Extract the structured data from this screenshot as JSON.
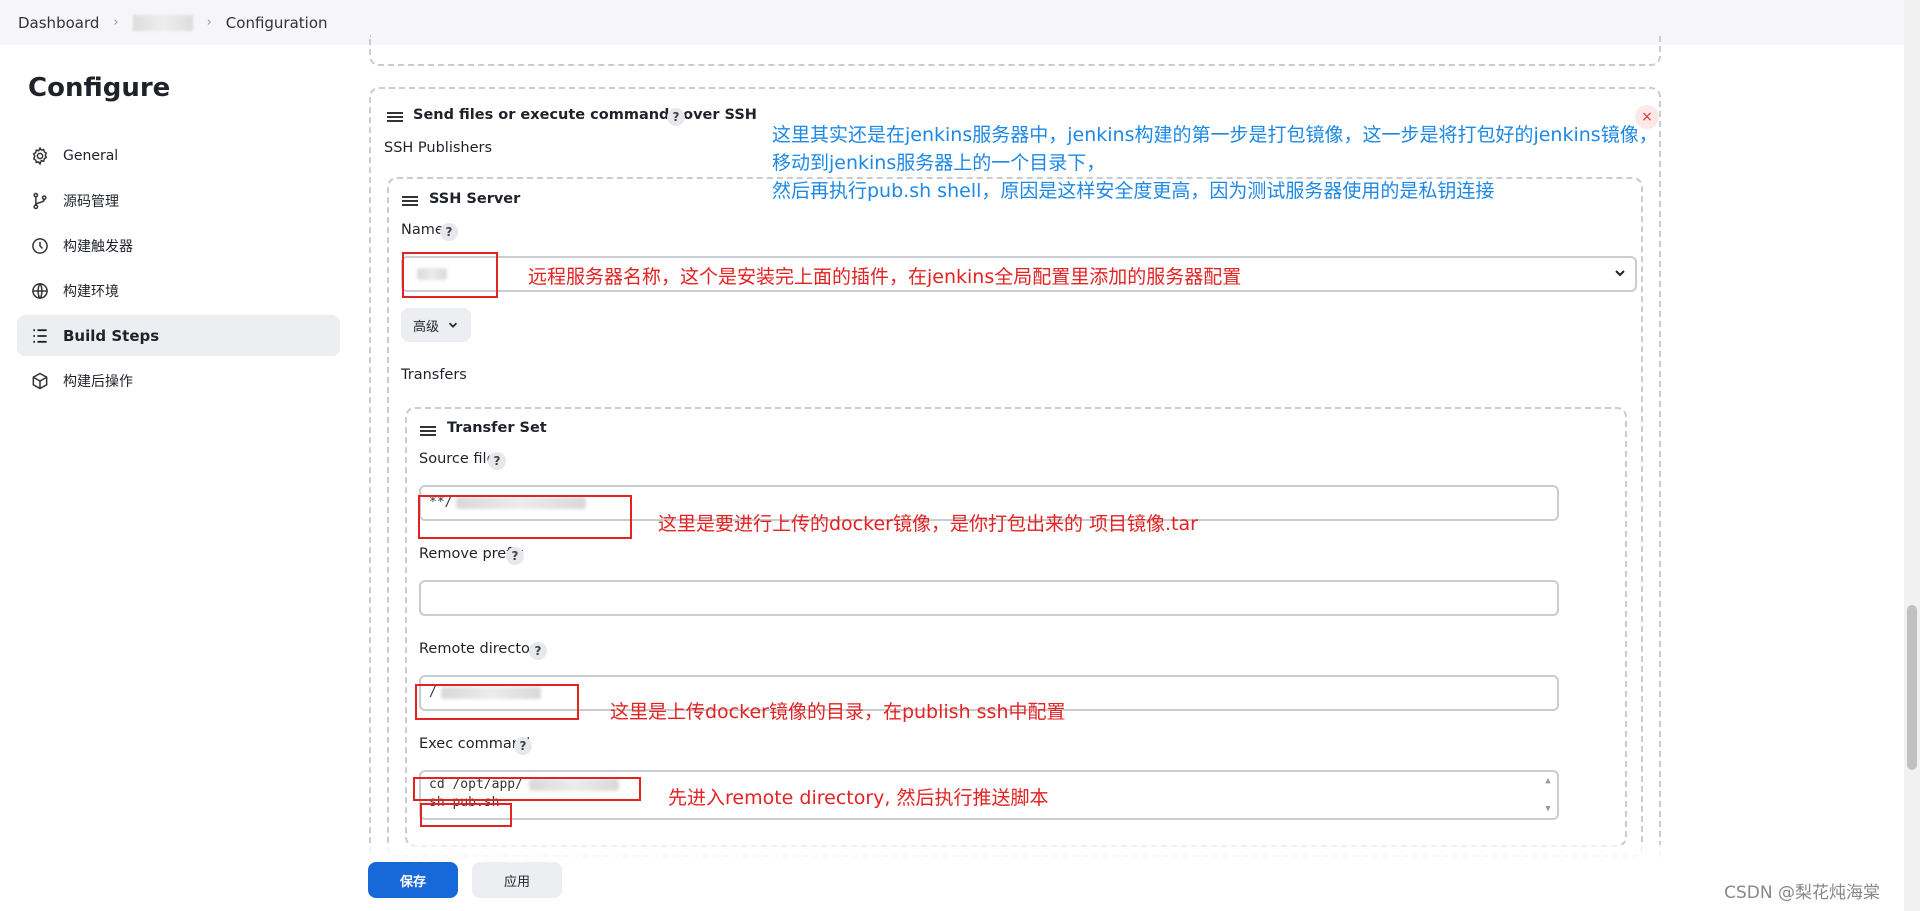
{
  "breadcrumb": {
    "home": "Dashboard",
    "current": "Configuration"
  },
  "sidebar": {
    "title": "Configure",
    "items": [
      {
        "label": "General",
        "icon": "gear-icon"
      },
      {
        "label": "源码管理",
        "icon": "branch-icon"
      },
      {
        "label": "构建触发器",
        "icon": "clock-icon"
      },
      {
        "label": "构建环境",
        "icon": "globe-icon"
      },
      {
        "label": "Build Steps",
        "icon": "list-icon",
        "active": true
      },
      {
        "label": "构建后操作",
        "icon": "cube-icon"
      }
    ]
  },
  "ssh_step": {
    "title": "Send files or execute commands over SSH",
    "publishers_label": "SSH Publishers",
    "close_symbol": "×",
    "server": {
      "title": "SSH Server",
      "name_label": "Name",
      "advanced_label": "高级",
      "transfers_label": "Transfers",
      "transfer_set": {
        "title": "Transfer Set",
        "source_files_label": "Source files",
        "source_files_value": "**/",
        "remove_prefix_label": "Remove prefix",
        "remove_prefix_value": "",
        "remote_dir_label": "Remote directory",
        "remote_dir_value": "/",
        "exec_label": "Exec command",
        "exec_line1": "cd /opt/app/",
        "exec_line2": "sh pub.sh"
      }
    }
  },
  "help_symbol": "?",
  "annotations": {
    "blue_line1": "这里其实还是在jenkins服务器中，jenkins构建的第一步是打包镜像，这一步是将打包好的jenkins镜像，",
    "blue_line2": "移动到jenkins服务器上的一个目录下，",
    "blue_line3": "然后再执行pub.sh shell，原因是这样安全度更高，因为测试服务器使用的是私钥连接",
    "name_note": "远程服务器名称，这个是安装完上面的插件，在jenkins全局配置里添加的服务器配置",
    "source_note": "这里是要进行上传的docker镜像，是你打包出来的 项目镜像.tar",
    "remote_note": "这里是上传docker镜像的目录，在publish ssh中配置",
    "exec_note": "先进入remote directory, 然后执行推送脚本"
  },
  "footer": {
    "save_label": "保存",
    "apply_label": "应用"
  },
  "watermark": "CSDN @梨花炖海棠",
  "colors": {
    "primary": "#1768d8",
    "annotation_red": "#e32222",
    "annotation_blue": "#1e88e5"
  }
}
